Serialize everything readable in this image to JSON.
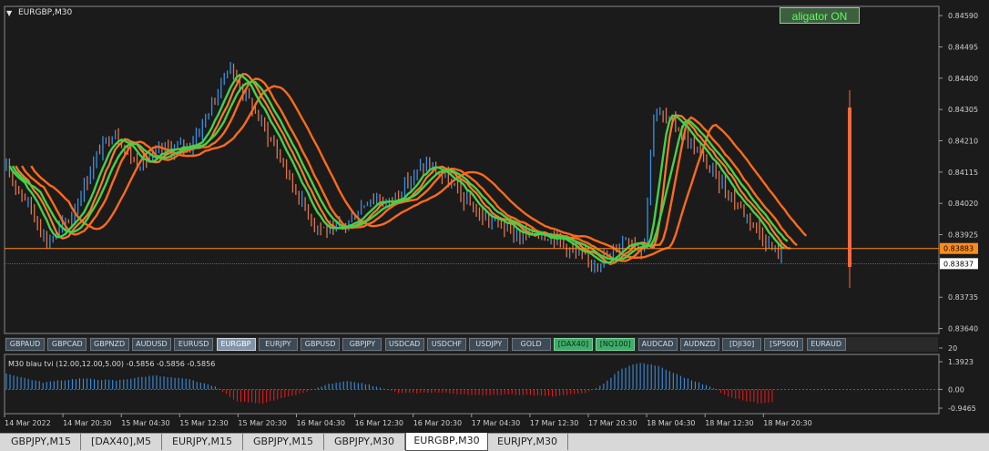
{
  "chart": {
    "title": "EURGBP,M30",
    "price_axis": [
      "0.84590",
      "0.84495",
      "0.84400",
      "0.84305",
      "0.84210",
      "0.84115",
      "0.84020",
      "0.83925",
      "0.83837",
      "0.83735",
      "0.83640"
    ],
    "price_ticks": [
      0.8459,
      0.84495,
      0.844,
      0.84305,
      0.8421,
      0.84115,
      0.8402,
      0.83925,
      0.83735,
      0.8364
    ],
    "price_range": [
      0.83625,
      0.84618
    ],
    "current_price": "0.83883",
    "current_price_value": 0.83883,
    "bid_price": "0.83837",
    "bid_price_value": 0.83837,
    "colors": {
      "background": "#1b1b1b",
      "bull": "#3b8fe0",
      "bear": "#e0744a",
      "alligator_fast": "#44d14a",
      "alligator_slow": "#ff6a1a",
      "price_line": "#ff8c1a",
      "grid": "#2b2b2b"
    }
  },
  "alligator_button": {
    "label": "aligator ON"
  },
  "symbol_bar": {
    "buttons": [
      {
        "label": "GBPAUD",
        "state": "normal"
      },
      {
        "label": "GBPCAD",
        "state": "normal"
      },
      {
        "label": "GBPNZD",
        "state": "normal"
      },
      {
        "label": "AUDUSD",
        "state": "normal"
      },
      {
        "label": "EURUSD",
        "state": "normal"
      },
      {
        "label": "EURGBP",
        "state": "active"
      },
      {
        "label": "EURJPY",
        "state": "normal"
      },
      {
        "label": "GBPUSD",
        "state": "normal"
      },
      {
        "label": "GBPJPY",
        "state": "normal"
      },
      {
        "label": "USDCAD",
        "state": "normal"
      },
      {
        "label": "USDCHF",
        "state": "normal"
      },
      {
        "label": "USDJPY",
        "state": "normal"
      },
      {
        "label": "GOLD",
        "state": "normal"
      },
      {
        "label": "[DAX40]",
        "state": "green"
      },
      {
        "label": "[NQ100]",
        "state": "green"
      },
      {
        "label": "AUDCAD",
        "state": "normal"
      },
      {
        "label": "AUDNZD",
        "state": "normal"
      },
      {
        "label": "[DJI30]",
        "state": "normal"
      },
      {
        "label": "[SP500]",
        "state": "normal"
      },
      {
        "label": "EURAUD",
        "state": "normal"
      }
    ]
  },
  "indicator": {
    "label": "M30  blau tvi (12.00,12.00,5.00)  -0.5856 -0.5856 -0.5856",
    "axis": [
      "20",
      "1.3923",
      "0.00",
      "-0.9465"
    ],
    "scale_max": 1.3923,
    "scale_min": -0.9465
  },
  "time_axis": [
    "14 Mar 2022",
    "14 Mar 20:30",
    "15 Mar 04:30",
    "15 Mar 12:30",
    "15 Mar 20:30",
    "16 Mar 04:30",
    "16 Mar 12:30",
    "16 Mar 20:30",
    "17 Mar 04:30",
    "17 Mar 12:30",
    "17 Mar 20:30",
    "18 Mar 04:30",
    "18 Mar 12:30",
    "18 Mar 20:30"
  ],
  "tabs": [
    {
      "label": "GBPJPY,M15",
      "active": false
    },
    {
      "label": "[DAX40],M5",
      "active": false
    },
    {
      "label": "EURJPY,M15",
      "active": false
    },
    {
      "label": "GBPJPY,M15",
      "active": false
    },
    {
      "label": "GBPJPY,M30",
      "active": false
    },
    {
      "label": "EURGBP,M30",
      "active": true
    },
    {
      "label": "EURJPY,M30",
      "active": false
    }
  ]
}
